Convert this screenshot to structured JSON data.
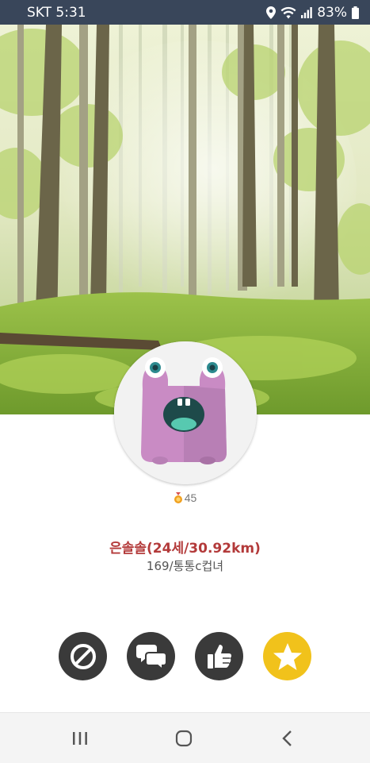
{
  "status_bar": {
    "carrier_time": "SKT 5:31",
    "battery": "83%",
    "icons": [
      "location-icon",
      "wifi-icon",
      "signal-icon",
      "battery-icon"
    ]
  },
  "profile": {
    "medal_count": "45",
    "name": "은솔솔(24세/30.92km)",
    "info": "169/통통c컵녀"
  },
  "actions": [
    {
      "name": "block-button",
      "icon": "block-icon"
    },
    {
      "name": "chat-button",
      "icon": "chat-bubbles-icon"
    },
    {
      "name": "like-button",
      "icon": "thumbs-up-icon"
    },
    {
      "name": "favorite-button",
      "icon": "star-icon"
    }
  ],
  "colors": {
    "status_bar_bg": "#39465a",
    "name_color": "#b33a3a",
    "action_dark": "#3a3a3a",
    "favorite_yellow": "#f1c21b"
  }
}
